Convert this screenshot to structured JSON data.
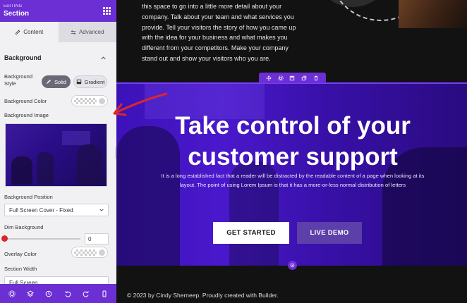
{
  "sidebar": {
    "editing_label": "EDITING",
    "title": "Section",
    "tabs": [
      {
        "label": "Content",
        "active": true
      },
      {
        "label": "Advanced",
        "active": false
      }
    ],
    "section_title": "Background",
    "background_style_label": "Background Style",
    "style_options": [
      {
        "label": "Solid",
        "selected": true
      },
      {
        "label": "Gradient",
        "selected": false
      }
    ],
    "background_color_label": "Background Color",
    "background_image_label": "Background Image",
    "background_position_label": "Background Position",
    "background_position_value": "Full Screen Cover - Fixed",
    "dim_background_label": "Dim Background",
    "dim_background_value": "0",
    "overlay_color_label": "Overlay Color",
    "section_width_label": "Section Width",
    "section_width_value": "Full Screen",
    "footer_icons": [
      "settings-icon",
      "layers-icon",
      "history-icon",
      "undo-icon",
      "redo-icon",
      "mobile-preview-icon"
    ]
  },
  "canvas": {
    "about_text": "this space to go into a little more detail about your company. Talk about your team and what services you provide. Tell your visitors the story of how you came up with the idea for your business and what makes you different from your competitors. Make your company stand out and show your visitors who you are.",
    "hero": {
      "title": "Take control of your customer support",
      "body": "It is a long established fact that a reader will be distracted by the readable content of a page when looking at its layout. The point of using Lorem Ipsum is that it has a more-or-less normal distribution of letters",
      "primary_cta": "GET STARTED",
      "secondary_cta": "LIVE DEMO",
      "toolbar_icons": [
        "move-icon",
        "settings-icon",
        "save-icon",
        "duplicate-icon",
        "delete-icon"
      ]
    },
    "footer_text": "© 2023 by Cindy Sherneep. Proudly created with Builder."
  },
  "colors": {
    "brand_purple": "#6b2fd4",
    "annotation_red": "#d9262f",
    "hero_blue": "#4a18cc"
  }
}
